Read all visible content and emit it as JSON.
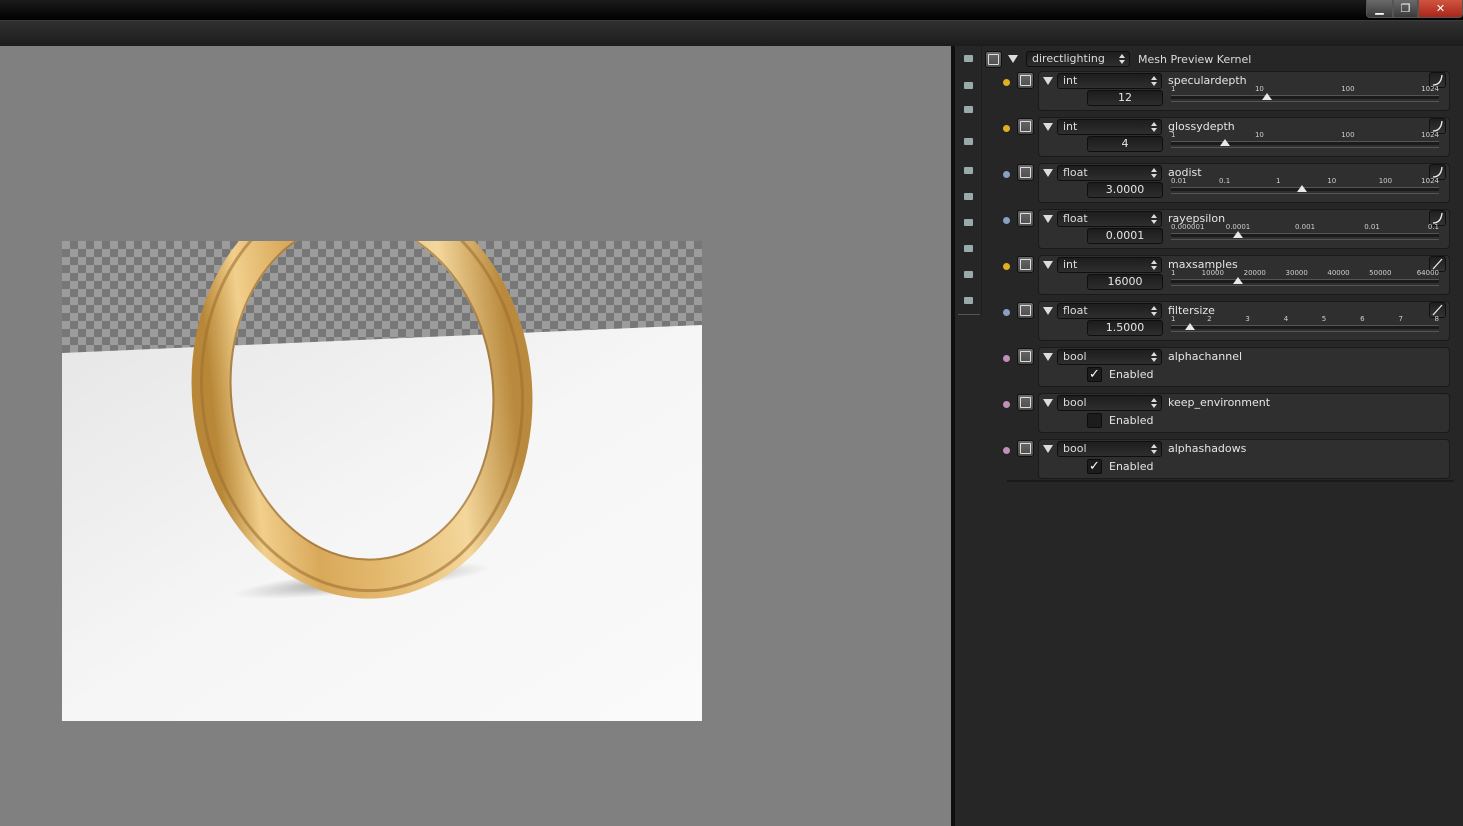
{
  "window": {
    "controls": {
      "minimize": "▁",
      "restore": "❐",
      "close": "✕"
    }
  },
  "properties": {
    "tabs": [
      "render-icon",
      "render-layers-icon",
      "scene-icon",
      "world-icon",
      "camera-icon",
      "object-data-icon",
      "material-icon",
      "texture-icon",
      "kernel-icon",
      "environment-icon"
    ],
    "kernel": {
      "icon": "node-tree-icon",
      "selected": "directlighting",
      "label": "Mesh Preview Kernel"
    },
    "params": [
      {
        "dot_color": "#e0b020",
        "icon": "int-socket-icon",
        "type": "int",
        "name": "speculardepth",
        "value": "12",
        "curve": true,
        "ticks": [
          "1",
          "10",
          "100",
          "1024"
        ],
        "tick_pos": [
          0.0,
          0.33,
          0.66,
          1.0
        ],
        "thumb_pos": 0.358
      },
      {
        "dot_color": "#e0b020",
        "icon": "int-socket-icon",
        "type": "int",
        "name": "glossydepth",
        "value": "4",
        "curve": true,
        "ticks": [
          "1",
          "10",
          "100",
          "1024"
        ],
        "tick_pos": [
          0.0,
          0.33,
          0.66,
          1.0
        ],
        "thumb_pos": 0.2
      },
      {
        "dot_color": "#8aa0c0",
        "icon": "float-socket-icon",
        "type": "float",
        "name": "aodist",
        "value": "3.0000",
        "curve": true,
        "ticks": [
          "0.01",
          "0.1",
          "1",
          "10",
          "100",
          "1024"
        ],
        "tick_pos": [
          0.0,
          0.2,
          0.4,
          0.6,
          0.8,
          1.0
        ],
        "thumb_pos": 0.49
      },
      {
        "dot_color": "#8aa0c0",
        "icon": "float-socket-icon",
        "type": "float",
        "name": "rayepsilon",
        "value": "0.0001",
        "curve": true,
        "ticks": [
          "0.000001",
          "0.0001",
          "0.001",
          "0.01",
          "0.1"
        ],
        "tick_pos": [
          0.0,
          0.25,
          0.5,
          0.75,
          1.0
        ],
        "thumb_pos": 0.25
      },
      {
        "dot_color": "#e0b020",
        "icon": "int-socket-icon",
        "type": "int",
        "name": "maxsamples",
        "value": "16000",
        "curve": false,
        "ticks": [
          "1",
          "10000",
          "20000",
          "30000",
          "40000",
          "50000",
          "64000"
        ],
        "tick_pos": [
          0.0,
          0.156,
          0.3125,
          0.469,
          0.625,
          0.781,
          1.0
        ],
        "thumb_pos": 0.25
      },
      {
        "dot_color": "#8aa0c0",
        "icon": "float-socket-icon",
        "type": "float",
        "name": "filtersize",
        "value": "1.5000",
        "curve": false,
        "ticks": [
          "1",
          "2",
          "3",
          "4",
          "5",
          "6",
          "7",
          "8"
        ],
        "tick_pos": [
          0.0,
          0.143,
          0.286,
          0.429,
          0.571,
          0.714,
          0.857,
          1.0
        ],
        "thumb_pos": 0.071
      },
      {
        "dot_color": "#c090b8",
        "icon": "bool-socket-icon",
        "type": "bool",
        "name": "alphachannel",
        "checked": true,
        "check_label": "Enabled"
      },
      {
        "dot_color": "#c090b8",
        "icon": "bool-socket-icon",
        "type": "bool",
        "name": "keep_environment",
        "checked": false,
        "check_label": "Enabled"
      },
      {
        "dot_color": "#c090b8",
        "icon": "bool-socket-icon",
        "type": "bool",
        "name": "alphashadows",
        "checked": true,
        "check_label": "Enabled"
      }
    ]
  }
}
